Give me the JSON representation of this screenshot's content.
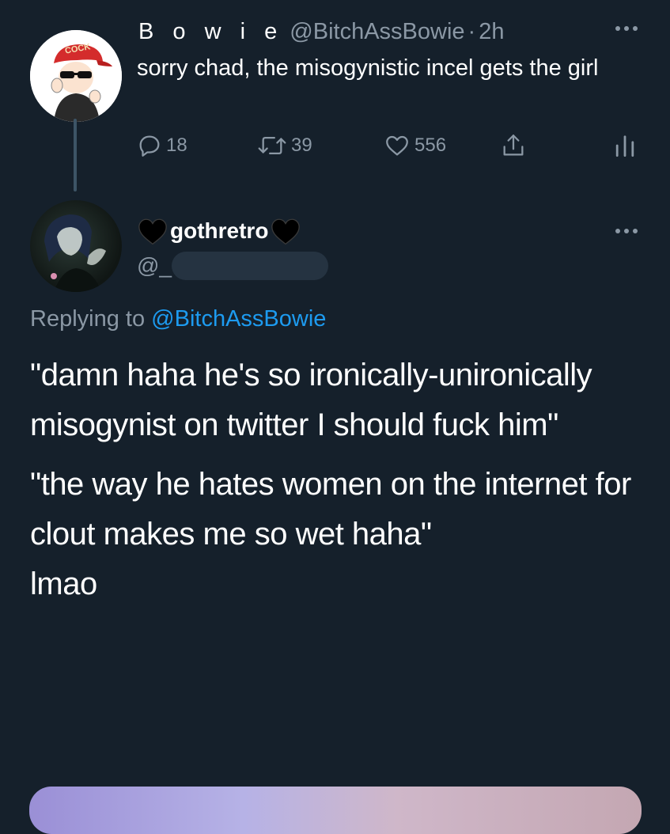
{
  "parent_tweet": {
    "display_name": "B o w i e",
    "handle": "@BitchAssBowie",
    "separator": "·",
    "time": "2h",
    "avatar_cap_text": "COCK",
    "text": "sorry chad, the misogynistic incel gets the girl",
    "replies": "18",
    "retweets": "39",
    "likes": "556"
  },
  "reply_tweet": {
    "display_name": "gothretro",
    "handle_prefix": "@_",
    "replying_label": "Replying to",
    "replying_to": "@BitchAssBowie",
    "paragraph_1": "\"damn haha he's so ironically-unironically misogynist on twitter I should fuck him\"",
    "paragraph_2": "\"the way he hates women on the internet for clout makes me so wet haha\"",
    "paragraph_3": "lmao"
  },
  "icons": {
    "more": "more-horizontal-icon",
    "reply": "reply-icon",
    "retweet": "retweet-icon",
    "like": "heart-icon",
    "share": "share-icon",
    "analytics": "analytics-icon",
    "name_decoration": "black-heart-icon"
  },
  "colors": {
    "background": "#15202b",
    "secondary_text": "#8b98a5",
    "link": "#1d9bf0",
    "thread_line": "#3d5466"
  }
}
